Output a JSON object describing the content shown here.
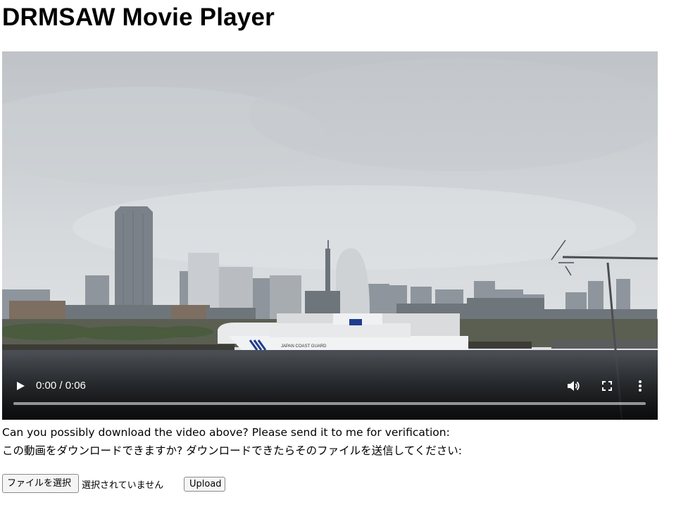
{
  "page": {
    "title": "DRMSAW Movie Player"
  },
  "video": {
    "time_display": "0:00 / 0:06",
    "progress_fraction": 0,
    "controls": {
      "play_icon": "play-icon",
      "volume_icon": "volume-icon",
      "fullscreen_icon": "fullscreen-icon",
      "more_icon": "more-vertical-icon"
    },
    "ship_hull_text": "JAPAN COAST GUARD"
  },
  "instructions": {
    "english": "Can you possibly download the video above? Please send it to me for verification:",
    "japanese": "この動画をダウンロードできますか? ダウンロードできたらそのファイルを送信してください:"
  },
  "upload": {
    "choose_button_label": "ファイルを選択",
    "no_file_text": "選択されていません",
    "upload_button_label": "Upload"
  }
}
